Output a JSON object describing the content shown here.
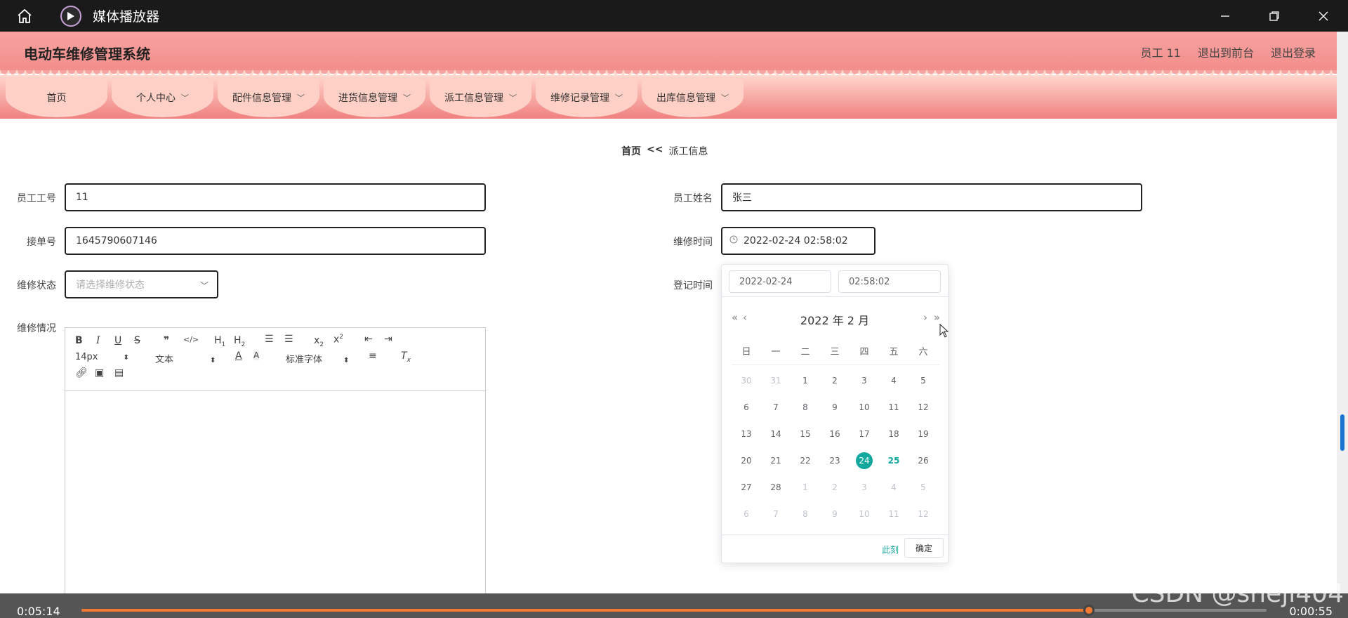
{
  "titlebar": {
    "app_title": "媒体播放器"
  },
  "header": {
    "system_title": "电动车维修管理系统",
    "user": "员工 11",
    "back_front": "退出到前台",
    "logout": "退出登录"
  },
  "nav": {
    "items": [
      {
        "label": "首页"
      },
      {
        "label": "个人中心"
      },
      {
        "label": "配件信息管理"
      },
      {
        "label": "进货信息管理"
      },
      {
        "label": "派工信息管理"
      },
      {
        "label": "维修记录管理"
      },
      {
        "label": "出库信息管理"
      }
    ]
  },
  "breadcrumb": {
    "home": "首页",
    "sep": "<<",
    "current": "派工信息"
  },
  "form": {
    "employee_no_label": "员工工号",
    "employee_no_value": "11",
    "employee_name_label": "员工姓名",
    "employee_name_value": "张三",
    "order_no_label": "接单号",
    "order_no_value": "1645790607146",
    "repair_time_label": "维修时间",
    "repair_time_value": "2022-02-24 02:58:02",
    "status_label": "维修状态",
    "status_placeholder": "请选择维修状态",
    "register_time_label": "登记时间",
    "detail_label": "维修情况"
  },
  "editor": {
    "font_size": "14px",
    "text_type": "文本",
    "font_family": "标准字体"
  },
  "datepicker": {
    "date_input": "2022-02-24",
    "time_input": "02:58:02",
    "title": "2022 年  2 月",
    "weekdays": [
      "日",
      "一",
      "二",
      "三",
      "四",
      "五",
      "六"
    ],
    "rows": [
      [
        "30",
        "31",
        "1",
        "2",
        "3",
        "4",
        "5"
      ],
      [
        "6",
        "7",
        "8",
        "9",
        "10",
        "11",
        "12"
      ],
      [
        "13",
        "14",
        "15",
        "16",
        "17",
        "18",
        "19"
      ],
      [
        "20",
        "21",
        "22",
        "23",
        "24",
        "25",
        "26"
      ],
      [
        "27",
        "28",
        "1",
        "2",
        "3",
        "4",
        "5"
      ],
      [
        "6",
        "7",
        "8",
        "9",
        "10",
        "11",
        "12"
      ]
    ],
    "selected": "24",
    "today": "25",
    "now_label": "此刻",
    "ok_label": "确定"
  },
  "player": {
    "elapsed": "0:05:14",
    "remaining": "0:00:55",
    "progress": 0.85
  },
  "watermark": "CSDN @sheji404"
}
